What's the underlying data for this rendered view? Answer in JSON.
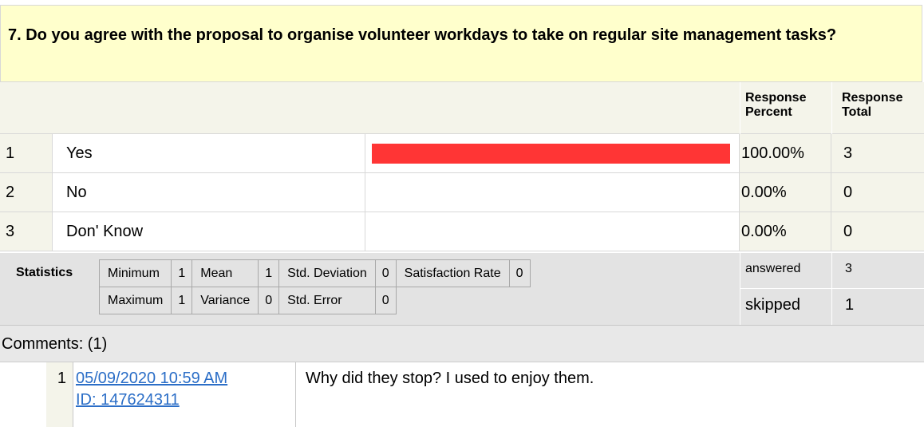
{
  "question": {
    "title": "7. Do you agree with the proposal to organise volunteer workdays to take on regular site management tasks?"
  },
  "columns": {
    "response_percent": [
      "Response",
      "Percent"
    ],
    "response_total": [
      "Response",
      "Total"
    ]
  },
  "responses": [
    {
      "num": "1",
      "label": "Yes",
      "percent": "100.00%",
      "total": "3",
      "fraction": 1.0
    },
    {
      "num": "2",
      "label": "No",
      "percent": "0.00%",
      "total": "0",
      "fraction": 0.0
    },
    {
      "num": "3",
      "label": "Don' Know",
      "percent": "0.00%",
      "total": "0",
      "fraction": 0.0
    }
  ],
  "bar_color": "#ff3535",
  "statistics": {
    "title": "Statistics",
    "minimum_label": "Minimum",
    "minimum": "1",
    "mean_label": "Mean",
    "mean": "1",
    "std_dev_label": "Std. Deviation",
    "std_dev": "0",
    "satisfaction_label": "Satisfaction Rate",
    "satisfaction": "0",
    "maximum_label": "Maximum",
    "maximum": "1",
    "variance_label": "Variance",
    "variance": "0",
    "std_error_label": "Std. Error",
    "std_error": "0"
  },
  "summary": {
    "answered_label": "answered",
    "answered": "3",
    "skipped_label": "skipped",
    "skipped": "1"
  },
  "comments": {
    "header": "Comments: (1)",
    "items": [
      {
        "num": "1",
        "date": "05/09/2020 10:59 AM",
        "id": "ID: 147624311",
        "text": "Why did they stop? I used to enjoy them."
      }
    ]
  }
}
